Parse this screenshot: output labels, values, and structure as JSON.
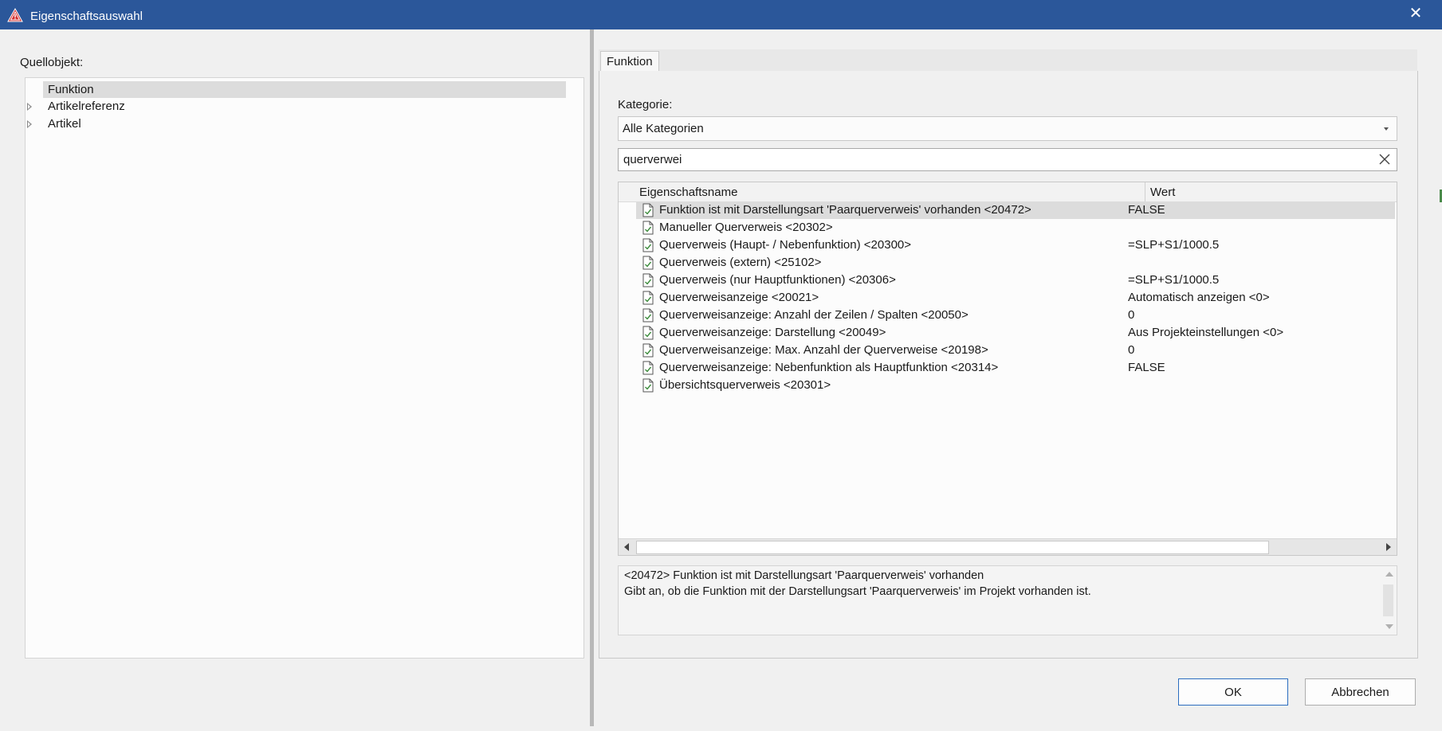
{
  "window": {
    "title": "Eigenschaftsauswahl"
  },
  "left": {
    "label": "Quellobjekt:",
    "tree": [
      {
        "label": "Funktion",
        "selected": true,
        "expandable": false
      },
      {
        "label": "Artikelreferenz",
        "selected": false,
        "expandable": true
      },
      {
        "label": "Artikel",
        "selected": false,
        "expandable": true
      }
    ]
  },
  "tabs": [
    {
      "label": "Funktion",
      "active": true
    }
  ],
  "category": {
    "label": "Kategorie:",
    "value": "Alle Kategorien"
  },
  "search": {
    "value": "querverwei"
  },
  "grid": {
    "columns": [
      "Eigenschaftsname",
      "Wert"
    ],
    "rows": [
      {
        "name": "Funktion ist mit Darstellungsart 'Paarquerverweis' vorhanden <20472>",
        "value": "FALSE",
        "selected": true
      },
      {
        "name": "Manueller Querverweis <20302>",
        "value": ""
      },
      {
        "name": "Querverweis (Haupt- / Nebenfunktion) <20300>",
        "value": "=SLP+S1/1000.5"
      },
      {
        "name": "Querverweis (extern) <25102>",
        "value": ""
      },
      {
        "name": "Querverweis (nur Hauptfunktionen) <20306>",
        "value": "=SLP+S1/1000.5"
      },
      {
        "name": "Querverweisanzeige <20021>",
        "value": "Automatisch anzeigen <0>"
      },
      {
        "name": "Querverweisanzeige: Anzahl der Zeilen / Spalten <20050>",
        "value": "0"
      },
      {
        "name": "Querverweisanzeige: Darstellung <20049>",
        "value": "Aus Projekteinstellungen <0>"
      },
      {
        "name": "Querverweisanzeige: Max. Anzahl der Querverweise <20198>",
        "value": "0"
      },
      {
        "name": "Querverweisanzeige: Nebenfunktion als Hauptfunktion <20314>",
        "value": "FALSE"
      },
      {
        "name": "Übersichtsquerverweis <20301>",
        "value": ""
      }
    ]
  },
  "description": {
    "line1": "<20472> Funktion ist mit Darstellungsart 'Paarquerverweis' vorhanden",
    "line2": "Gibt an, ob die Funktion mit der Darstellungsart 'Paarquerverweis' im Projekt vorhanden ist."
  },
  "buttons": {
    "ok": "OK",
    "cancel": "Abbrechen"
  },
  "colors": {
    "titlebar": "#2b579a",
    "selection": "#dcdcdc",
    "icon_check": "#3a8a3a",
    "app_icon": "#d32f2f"
  }
}
